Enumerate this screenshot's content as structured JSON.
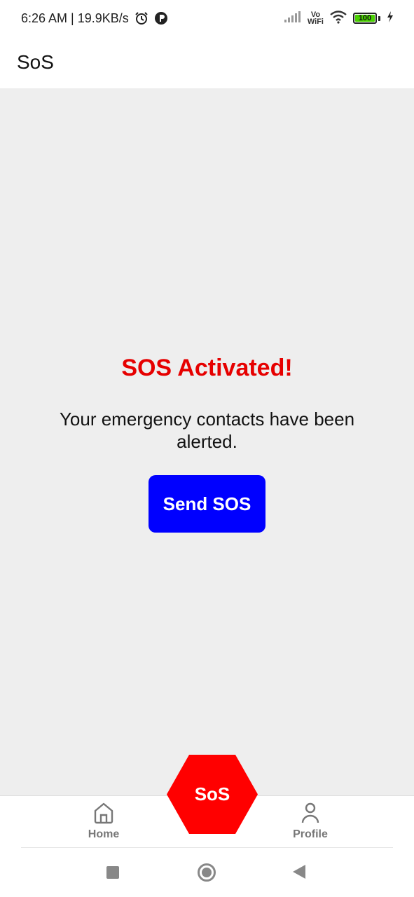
{
  "status_bar": {
    "time_speed": "6:26 AM | 19.9KB/s",
    "vo": "Vo",
    "wifi": "WiFi",
    "battery_level": "100",
    "icons": [
      "alarm-icon",
      "app-notification-icon",
      "signal-icon",
      "wifi-icon",
      "battery-icon",
      "charging-icon"
    ]
  },
  "app_bar": {
    "title": "SoS"
  },
  "main": {
    "heading": "SOS Activated!",
    "message": "Your emergency contacts have been alerted.",
    "send_button": "Send SOS"
  },
  "bottom_nav": {
    "home_label": "Home",
    "sos_label": "SoS",
    "profile_label": "Profile"
  },
  "colors": {
    "accent_red": "#e60000",
    "sos_red": "#ff0000",
    "send_blue": "#0000ff",
    "background": "#eeeeee"
  }
}
